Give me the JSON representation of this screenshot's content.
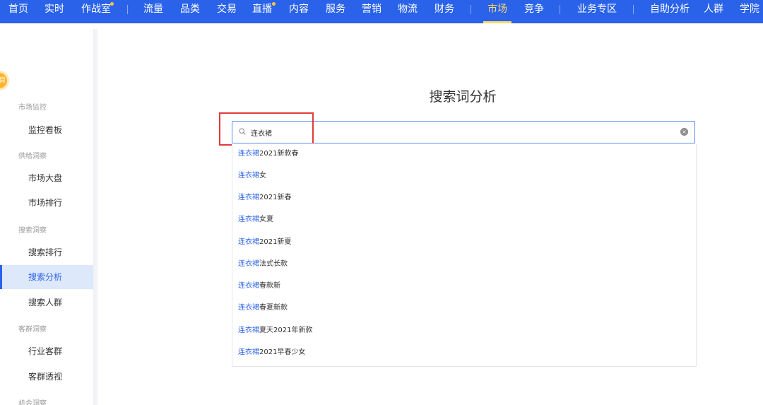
{
  "nav": {
    "items": [
      "首页",
      "实时",
      "作战室",
      "流量",
      "品类",
      "交易",
      "直播",
      "内容",
      "服务",
      "营销",
      "物流",
      "财务",
      "市场",
      "竞争",
      "业务专区",
      "自助分析",
      "人群",
      "学院"
    ],
    "active": "市场"
  },
  "sidebar": {
    "badge_text": "目",
    "groups": [
      {
        "label": "市场监控",
        "items": [
          "监控看板"
        ]
      },
      {
        "label": "供给洞察",
        "items": [
          "市场大盘",
          "市场排行"
        ]
      },
      {
        "label": "搜索洞察",
        "items": [
          "搜索排行",
          "搜索分析",
          "搜索人群"
        ]
      },
      {
        "label": "客群洞察",
        "items": [
          "行业客群",
          "客群透视"
        ]
      },
      {
        "label": "机会洞察",
        "items": []
      }
    ],
    "active_item": "搜索分析"
  },
  "main": {
    "title": "搜索词分析",
    "search": {
      "value": "连衣裙"
    },
    "suggestions": [
      {
        "keyword": "连衣裙",
        "rest": "2021新款春"
      },
      {
        "keyword": "连衣裙",
        "rest": "女"
      },
      {
        "keyword": "连衣裙",
        "rest": "2021新春"
      },
      {
        "keyword": "连衣裙",
        "rest": "女夏"
      },
      {
        "keyword": "连衣裙",
        "rest": "2021新夏"
      },
      {
        "keyword": "连衣裙",
        "rest": "法式长款"
      },
      {
        "keyword": "连衣裙",
        "rest": "春款新"
      },
      {
        "keyword": "连衣裙",
        "rest": "春夏新款"
      },
      {
        "keyword": "连衣裙",
        "rest": "夏天2021年新款"
      },
      {
        "keyword": "连衣裙",
        "rest": "2021早春少女"
      }
    ]
  },
  "colors": {
    "brand": "#2a62ea",
    "active_tab": "#ffd86a",
    "highlight": "#e23a3a"
  }
}
